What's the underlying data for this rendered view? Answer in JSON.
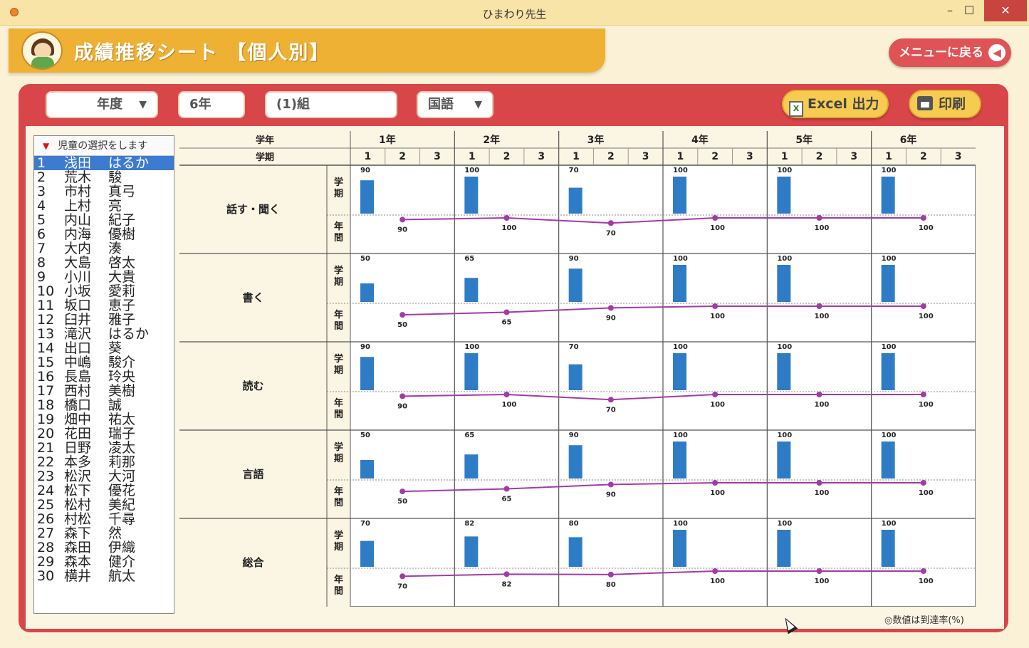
{
  "window": {
    "title": "ひまわり先生",
    "minimize": "–",
    "maximize": "☐",
    "close": "✕"
  },
  "header": {
    "title": "成績推移シート 【個人別】",
    "menu_button": "メニューに戻る",
    "menu_arrow": "◀"
  },
  "filters": {
    "year": {
      "label": "年度",
      "caret": "▼"
    },
    "grade": {
      "label": "6年"
    },
    "class": {
      "label": "(1)組"
    },
    "subject": {
      "label": "国語",
      "caret": "▼"
    }
  },
  "actions": {
    "excel": "Excel 出力",
    "print": "印刷",
    "excel_icon": "X"
  },
  "student_list": {
    "header": "児童の選択をします",
    "header_icon": "▼",
    "selected_index": 0,
    "students": [
      {
        "no": "1",
        "last": "浅田",
        "first": "はるか"
      },
      {
        "no": "2",
        "last": "荒木",
        "first": "駿"
      },
      {
        "no": "3",
        "last": "市村",
        "first": "真弓"
      },
      {
        "no": "4",
        "last": "上村",
        "first": "亮"
      },
      {
        "no": "5",
        "last": "内山",
        "first": "紀子"
      },
      {
        "no": "6",
        "last": "内海",
        "first": "優樹"
      },
      {
        "no": "7",
        "last": "大内",
        "first": "湊"
      },
      {
        "no": "8",
        "last": "大島",
        "first": "啓太"
      },
      {
        "no": "9",
        "last": "小川",
        "first": "大貴"
      },
      {
        "no": "10",
        "last": "小坂",
        "first": "愛莉"
      },
      {
        "no": "11",
        "last": "坂口",
        "first": "恵子"
      },
      {
        "no": "12",
        "last": "臼井",
        "first": "雅子"
      },
      {
        "no": "13",
        "last": "滝沢",
        "first": "はるか"
      },
      {
        "no": "14",
        "last": "出口",
        "first": "葵"
      },
      {
        "no": "15",
        "last": "中嶋",
        "first": "駿介"
      },
      {
        "no": "16",
        "last": "長島",
        "first": "玲央"
      },
      {
        "no": "17",
        "last": "西村",
        "first": "美樹"
      },
      {
        "no": "18",
        "last": "橋口",
        "first": "誠"
      },
      {
        "no": "19",
        "last": "畑中",
        "first": "祐太"
      },
      {
        "no": "20",
        "last": "花田",
        "first": "瑞子"
      },
      {
        "no": "21",
        "last": "日野",
        "first": "凌太"
      },
      {
        "no": "22",
        "last": "本多",
        "first": "莉那"
      },
      {
        "no": "23",
        "last": "松沢",
        "first": "大河"
      },
      {
        "no": "24",
        "last": "松下",
        "first": "優花"
      },
      {
        "no": "25",
        "last": "松村",
        "first": "美紀"
      },
      {
        "no": "26",
        "last": "村松",
        "first": "千尋"
      },
      {
        "no": "27",
        "last": "森下",
        "first": "然"
      },
      {
        "no": "28",
        "last": "森田",
        "first": "伊織"
      },
      {
        "no": "29",
        "last": "森本",
        "first": "健介"
      },
      {
        "no": "30",
        "last": "横井",
        "first": "航太"
      }
    ]
  },
  "grid": {
    "grade_header": "学年",
    "term_header": "学期",
    "grades": [
      "1年",
      "2年",
      "3年",
      "4年",
      "5年",
      "6年"
    ],
    "terms": [
      "1",
      "2",
      "3"
    ],
    "row_label_term": "学期",
    "row_label_year": "年間"
  },
  "chart_data": {
    "type": "bar",
    "note": "◎数値は到達率(%)",
    "ylim": [
      0,
      100
    ],
    "categories": [
      "1年",
      "2年",
      "3年",
      "4年",
      "5年",
      "6年"
    ],
    "series": [
      {
        "name": "話す・聞く",
        "values": [
          90,
          100,
          70,
          100,
          100,
          100
        ]
      },
      {
        "name": "書く",
        "values": [
          50,
          65,
          90,
          100,
          100,
          100
        ]
      },
      {
        "name": "読む",
        "values": [
          90,
          100,
          70,
          100,
          100,
          100
        ]
      },
      {
        "name": "言語",
        "values": [
          50,
          65,
          90,
          100,
          100,
          100
        ]
      },
      {
        "name": "総合",
        "values": [
          70,
          82,
          80,
          100,
          100,
          100
        ]
      }
    ],
    "bar_color": "#2f7cc6",
    "line_color": "#a33aa8"
  },
  "footnote": "◎数値は到達率(%)"
}
